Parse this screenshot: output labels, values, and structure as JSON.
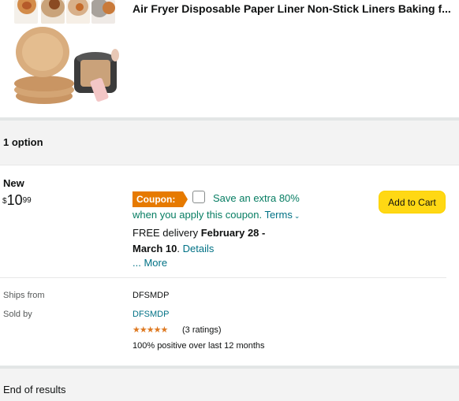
{
  "product": {
    "title": "Air Fryer Disposable Paper Liner Non-Stick Liners Baking f..."
  },
  "options": {
    "count_label": "1 option"
  },
  "offer": {
    "condition": "New",
    "price_symbol": "$",
    "price_whole": "10",
    "price_fraction": "99",
    "coupon_badge": "Coupon:",
    "coupon_text": "Save an extra 80%",
    "coupon_line2": "when you apply this coupon.",
    "terms_label": "Terms",
    "delivery_prefix": "FREE delivery",
    "delivery_dates_1": "February 28 -",
    "delivery_dates_2": "March 10",
    "details_label": "Details",
    "more_label": "... More",
    "add_to_cart_label": "Add to Cart"
  },
  "seller": {
    "ships_from_label": "Ships from",
    "ships_from_value": "DFSMDP",
    "sold_by_label": "Sold by",
    "sold_by_value": "DFSMDP",
    "stars": "★★★★★",
    "ratings": "(3 ratings)",
    "positive": "100% positive over last 12 months"
  },
  "footer": {
    "end_label": "End of results"
  },
  "colors": {
    "link": "#007185",
    "coupon_green": "#067d62",
    "coupon_badge": "#e67a00",
    "button_yellow": "#ffd814",
    "star_orange": "#de7921"
  }
}
